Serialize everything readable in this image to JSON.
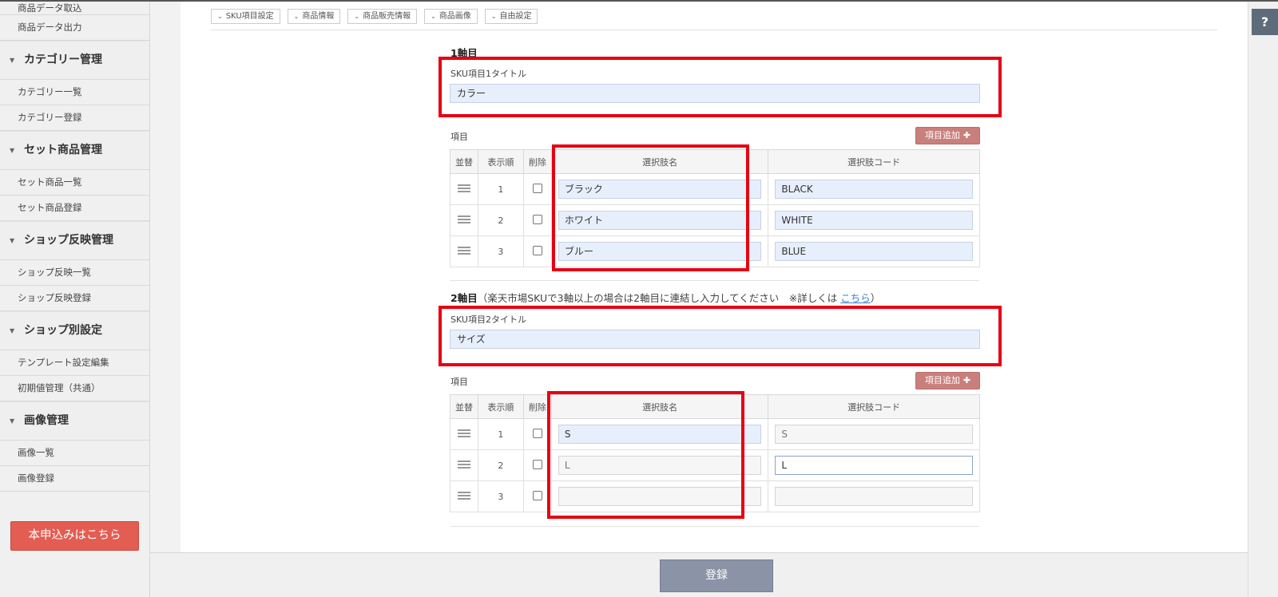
{
  "sidebar": {
    "groups": [
      {
        "items": [
          "商品データ取込",
          "商品データ出力"
        ]
      },
      {
        "title": "カテゴリー管理",
        "items": [
          "カテゴリー一覧",
          "カテゴリー登録"
        ]
      },
      {
        "title": "セット商品管理",
        "items": [
          "セット商品一覧",
          "セット商品登録"
        ]
      },
      {
        "title": "ショップ反映管理",
        "items": [
          "ショップ反映一覧",
          "ショップ反映登録"
        ]
      },
      {
        "title": "ショップ別設定",
        "items": [
          "テンプレート設定編集",
          "初期値管理（共通）"
        ]
      },
      {
        "title": "画像管理",
        "items": [
          "画像一覧",
          "画像登録"
        ]
      }
    ],
    "apply_button": "本申込みはこちら"
  },
  "help": "?",
  "tabs": [
    "SKU項目設定",
    "商品情報",
    "商品販売情報",
    "商品画像",
    "自由設定"
  ],
  "axis1": {
    "heading": "1軸目",
    "title_label": "SKU項目1タイトル",
    "title_value": "カラー",
    "items_label": "項目",
    "add_button": "項目追加",
    "headers": [
      "並替",
      "表示順",
      "削除",
      "選択肢名",
      "選択肢コード"
    ],
    "rows": [
      {
        "order": "1",
        "name": "ブラック",
        "code": "BLACK"
      },
      {
        "order": "2",
        "name": "ホワイト",
        "code": "WHITE"
      },
      {
        "order": "3",
        "name": "ブルー",
        "code": "BLUE"
      }
    ]
  },
  "axis2": {
    "heading": "2軸目",
    "note_prefix": "（楽天市場SKUで3軸以上の場合は2軸目に連結し入力してください　※詳しくは ",
    "note_link": "こちら",
    "note_suffix": "）",
    "title_label": "SKU項目2タイトル",
    "title_value": "サイズ",
    "items_label": "項目",
    "add_button": "項目追加",
    "headers": [
      "並替",
      "表示順",
      "削除",
      "選択肢名",
      "選択肢コード"
    ],
    "rows": [
      {
        "order": "1",
        "name": "S",
        "code": "S"
      },
      {
        "order": "2",
        "name": "L",
        "code": "L"
      },
      {
        "order": "3",
        "name": "",
        "code": ""
      }
    ]
  },
  "submit_button": "登録"
}
